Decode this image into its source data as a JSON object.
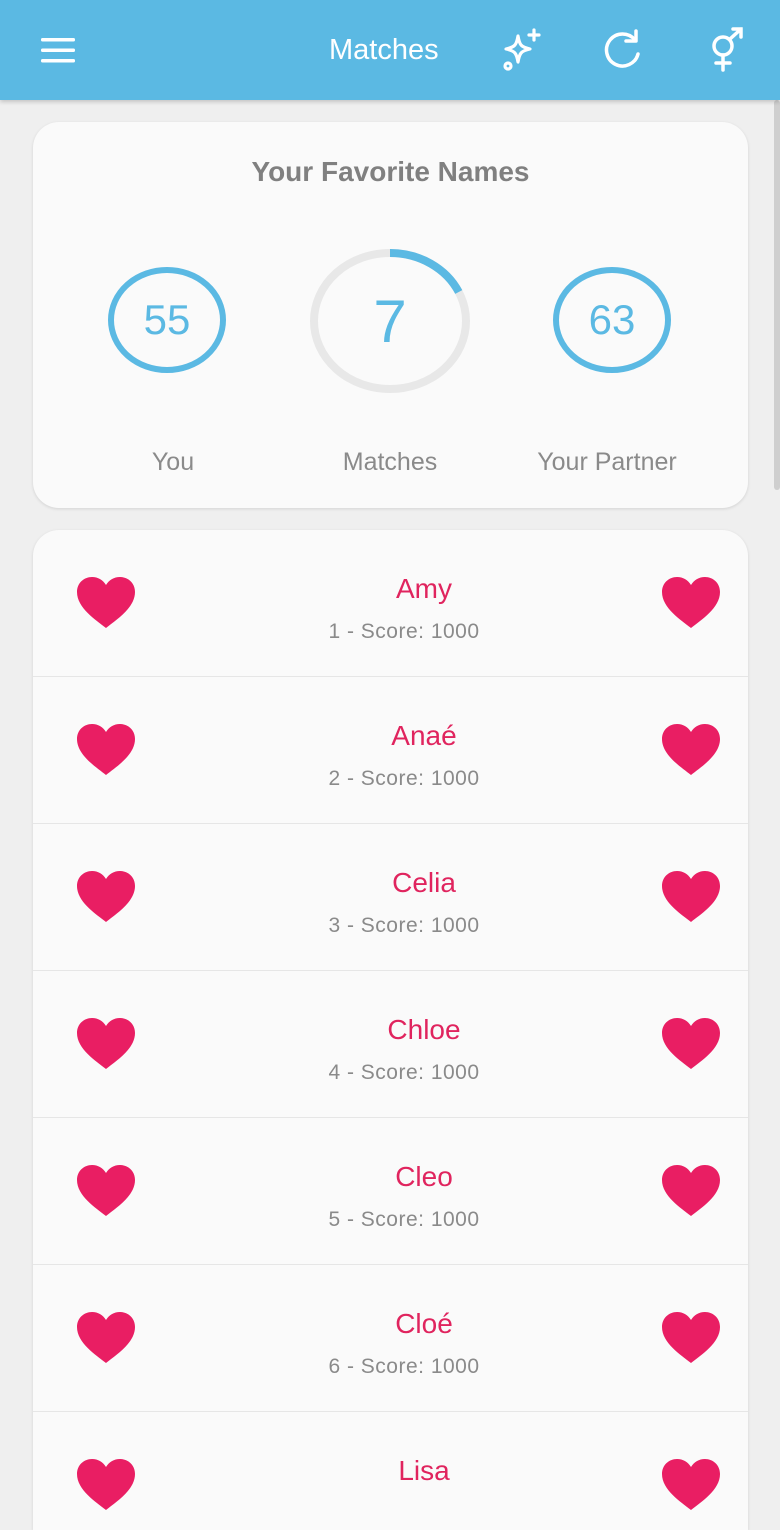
{
  "appbar": {
    "title": "Matches",
    "menu_icon": "hamburger-menu-icon",
    "actions": [
      "sparkles-icon",
      "refresh-icon",
      "gender-icon"
    ],
    "color": "#5bb9e3"
  },
  "summary": {
    "title": "Your Favorite Names",
    "you": {
      "value": "55",
      "label": "You"
    },
    "matches": {
      "value": "7",
      "label": "Matches",
      "progress_fraction": 0.18
    },
    "partner": {
      "value": "63",
      "label": "Your Partner"
    },
    "ring_color": "#5bb9e3",
    "track_color": "#e8e8e8"
  },
  "matches_list": [
    {
      "name": "Amy",
      "score": "1 - Score: 1000"
    },
    {
      "name": "Anaé",
      "score": "2 - Score: 1000"
    },
    {
      "name": "Celia",
      "score": "3 - Score: 1000"
    },
    {
      "name": "Chloe",
      "score": "4 - Score: 1000"
    },
    {
      "name": "Cleo",
      "score": "5 - Score: 1000"
    },
    {
      "name": "Cloé",
      "score": "6 - Score: 1000"
    },
    {
      "name": "Lisa",
      "score": ""
    }
  ],
  "heart_color": "#e91e63",
  "name_color": "#e0245e"
}
